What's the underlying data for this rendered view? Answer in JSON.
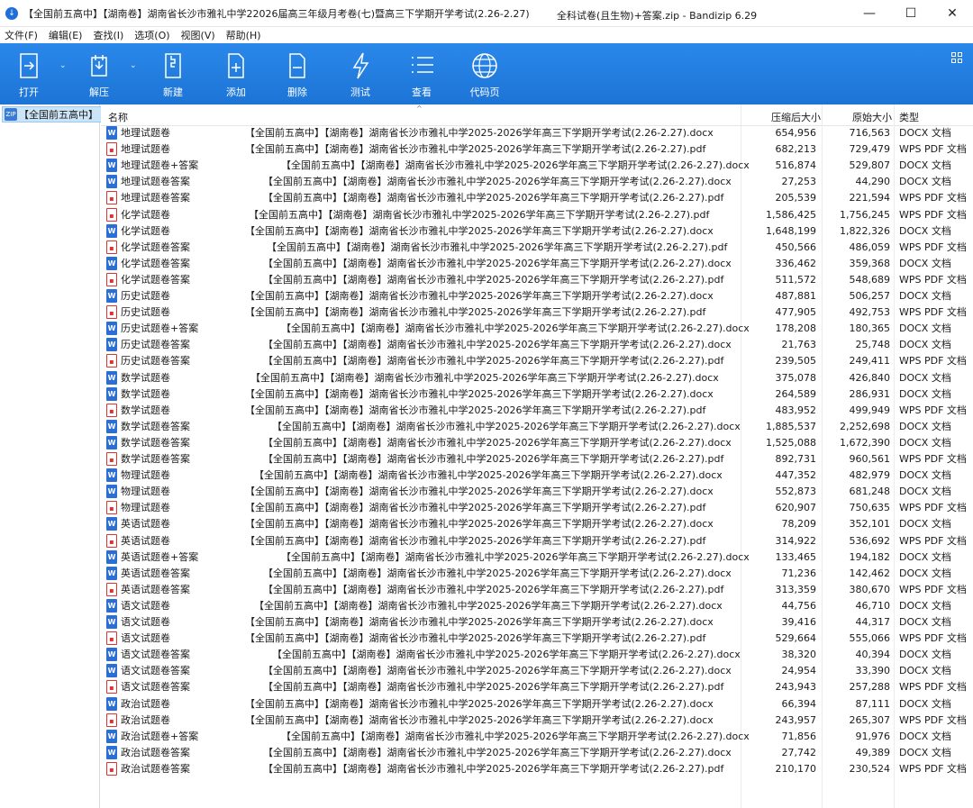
{
  "window": {
    "app_icon": "download-arrow-icon",
    "title_left": "【全国前五高中】【湖南卷】湖南省长沙市雅礼中学22026届高三年级月考卷(七)暨高三下学期开学考试(2.26-2.27)",
    "title_right": "全科试卷(且生物)+答案.zip - Bandizip 6.29",
    "minimize": "—",
    "maximize": "☐",
    "close": "✕"
  },
  "menu": [
    "文件(F)",
    "编辑(E)",
    "查找(I)",
    "选项(O)",
    "视图(V)",
    "帮助(H)"
  ],
  "toolbar": [
    {
      "label": "打开",
      "icon": "open-icon"
    },
    {
      "label": "解压",
      "icon": "extract-icon"
    },
    {
      "label": "新建",
      "icon": "new-archive-icon"
    },
    {
      "label": "添加",
      "icon": "add-file-icon"
    },
    {
      "label": "删除",
      "icon": "delete-file-icon"
    },
    {
      "label": "测试",
      "icon": "test-lightning-icon"
    },
    {
      "label": "查看",
      "icon": "view-list-icon"
    },
    {
      "label": "代码页",
      "icon": "globe-icon"
    }
  ],
  "tree": {
    "label": "【全国前五高中】",
    "icon": "zip-folder-icon"
  },
  "columns": {
    "name": "名称",
    "compressed": "压缩后大小",
    "original": "原始大小",
    "type": "类型"
  },
  "rows": [
    {
      "name": "地理试题卷",
      "full": "【全国前五高中】【湖南卷】湖南省长沙市雅礼中学2025-2026学年高三下学期开学考试(2.26-2.27).docx",
      "comp": "654,956",
      "orig": "716,563",
      "type": "DOCX 文档",
      "kind": "docx",
      "offset": 160
    },
    {
      "name": "地理试题卷",
      "full": "【全国前五高中】【湖南卷】湖南省长沙市雅礼中学2025-2026学年高三下学期开学考试(2.26-2.27).pdf",
      "comp": "682,213",
      "orig": "729,479",
      "type": "WPS PDF 文档",
      "kind": "pdf",
      "offset": 160
    },
    {
      "name": "地理试题卷+答案",
      "full": "【全国前五高中】【湖南卷】湖南省长沙市雅礼中学2025-2026学年高三下学期开学考试(2.26-2.27).docx",
      "comp": "516,874",
      "orig": "529,807",
      "type": "DOCX 文档",
      "kind": "docx",
      "offset": 200
    },
    {
      "name": "地理试题卷答案",
      "full": "【全国前五高中】【湖南卷】湖南省长沙市雅礼中学2025-2026学年高三下学期开学考试(2.26-2.27).docx",
      "comp": "27,253",
      "orig": "44,290",
      "type": "DOCX 文档",
      "kind": "docx",
      "offset": 180
    },
    {
      "name": "地理试题卷答案",
      "full": "【全国前五高中】【湖南卷】湖南省长沙市雅礼中学2025-2026学年高三下学期开学考试(2.26-2.27).pdf",
      "comp": "205,539",
      "orig": "221,594",
      "type": "WPS PDF 文档",
      "kind": "pdf",
      "offset": 180
    },
    {
      "name": "化学试题卷",
      "full": "【全国前五高中】【湖南卷】湖南省长沙市雅礼中学2025-2026学年高三下学期开学考试(2.26-2.27).pdf",
      "comp": "1,586,425",
      "orig": "1,756,245",
      "type": "WPS PDF 文档",
      "kind": "pdf",
      "offset": 164
    },
    {
      "name": "化学试题卷",
      "full": "【全国前五高中】【湖南卷】湖南省长沙市雅礼中学2025-2026学年高三下学期开学考试(2.26-2.27).docx",
      "comp": "1,648,199",
      "orig": "1,822,326",
      "type": "DOCX 文档",
      "kind": "docx",
      "offset": 160
    },
    {
      "name": "化学试题卷答案",
      "full": "【全国前五高中】【湖南卷】湖南省长沙市雅礼中学2025-2026学年高三下学期开学考试(2.26-2.27).pdf",
      "comp": "450,566",
      "orig": "486,059",
      "type": "WPS PDF 文档",
      "kind": "pdf",
      "offset": 184
    },
    {
      "name": "化学试题卷答案",
      "full": "【全国前五高中】【湖南卷】湖南省长沙市雅礼中学2025-2026学年高三下学期开学考试(2.26-2.27).docx",
      "comp": "336,462",
      "orig": "359,368",
      "type": "DOCX 文档",
      "kind": "docx",
      "offset": 180
    },
    {
      "name": "化学试题卷答案",
      "full": "【全国前五高中】【湖南卷】湖南省长沙市雅礼中学2025-2026学年高三下学期开学考试(2.26-2.27).pdf",
      "comp": "511,572",
      "orig": "548,689",
      "type": "WPS PDF 文档",
      "kind": "pdf",
      "offset": 180
    },
    {
      "name": "历史试题卷",
      "full": "【全国前五高中】【湖南卷】湖南省长沙市雅礼中学2025-2026学年高三下学期开学考试(2.26-2.27).docx",
      "comp": "487,881",
      "orig": "506,257",
      "type": "DOCX 文档",
      "kind": "docx",
      "offset": 160
    },
    {
      "name": "历史试题卷",
      "full": "【全国前五高中】【湖南卷】湖南省长沙市雅礼中学2025-2026学年高三下学期开学考试(2.26-2.27).pdf",
      "comp": "477,905",
      "orig": "492,753",
      "type": "WPS PDF 文档",
      "kind": "pdf",
      "offset": 160
    },
    {
      "name": "历史试题卷+答案",
      "full": "【全国前五高中】【湖南卷】湖南省长沙市雅礼中学2025-2026学年高三下学期开学考试(2.26-2.27).docx",
      "comp": "178,208",
      "orig": "180,365",
      "type": "DOCX 文档",
      "kind": "docx",
      "offset": 200
    },
    {
      "name": "历史试题卷答案",
      "full": "【全国前五高中】【湖南卷】湖南省长沙市雅礼中学2025-2026学年高三下学期开学考试(2.26-2.27).docx",
      "comp": "21,763",
      "orig": "25,748",
      "type": "DOCX 文档",
      "kind": "docx",
      "offset": 180
    },
    {
      "name": "历史试题卷答案",
      "full": "【全国前五高中】【湖南卷】湖南省长沙市雅礼中学2025-2026学年高三下学期开学考试(2.26-2.27).pdf",
      "comp": "239,505",
      "orig": "249,411",
      "type": "WPS PDF 文档",
      "kind": "pdf",
      "offset": 180
    },
    {
      "name": "数学试题卷",
      "full": "【全国前五高中】【湖南卷】湖南省长沙市雅礼中学2025-2026学年高三下学期开学考试(2.26-2.27).docx",
      "comp": "375,078",
      "orig": "426,840",
      "type": "DOCX 文档",
      "kind": "docx",
      "offset": 166
    },
    {
      "name": "数学试题卷",
      "full": "【全国前五高中】【湖南卷】湖南省长沙市雅礼中学2025-2026学年高三下学期开学考试(2.26-2.27).docx",
      "comp": "264,589",
      "orig": "286,931",
      "type": "DOCX 文档",
      "kind": "docx",
      "offset": 160
    },
    {
      "name": "数学试题卷",
      "full": "【全国前五高中】【湖南卷】湖南省长沙市雅礼中学2025-2026学年高三下学期开学考试(2.26-2.27).pdf",
      "comp": "483,952",
      "orig": "499,949",
      "type": "WPS PDF 文档",
      "kind": "pdf",
      "offset": 160
    },
    {
      "name": "数学试题卷答案",
      "full": "【全国前五高中】【湖南卷】湖南省长沙市雅礼中学2025-2026学年高三下学期开学考试(2.26-2.27).docx",
      "comp": "1,885,537",
      "orig": "2,252,698",
      "type": "DOCX 文档",
      "kind": "docx",
      "offset": 190
    },
    {
      "name": "数学试题卷答案",
      "full": "【全国前五高中】【湖南卷】湖南省长沙市雅礼中学2025-2026学年高三下学期开学考试(2.26-2.27).docx",
      "comp": "1,525,088",
      "orig": "1,672,390",
      "type": "DOCX 文档",
      "kind": "docx",
      "offset": 180
    },
    {
      "name": "数学试题卷答案",
      "full": "【全国前五高中】【湖南卷】湖南省长沙市雅礼中学2025-2026学年高三下学期开学考试(2.26-2.27).pdf",
      "comp": "892,731",
      "orig": "960,561",
      "type": "WPS PDF 文档",
      "kind": "pdf",
      "offset": 180
    },
    {
      "name": "物理试题卷",
      "full": "【全国前五高中】【湖南卷】湖南省长沙市雅礼中学2025-2026学年高三下学期开学考试(2.26-2.27).docx",
      "comp": "447,352",
      "orig": "482,979",
      "type": "DOCX 文档",
      "kind": "docx",
      "offset": 170
    },
    {
      "name": "物理试题卷",
      "full": "【全国前五高中】【湖南卷】湖南省长沙市雅礼中学2025-2026学年高三下学期开学考试(2.26-2.27).docx",
      "comp": "552,873",
      "orig": "681,248",
      "type": "DOCX 文档",
      "kind": "docx",
      "offset": 160
    },
    {
      "name": "物理试题卷",
      "full": "【全国前五高中】【湖南卷】湖南省长沙市雅礼中学2025-2026学年高三下学期开学考试(2.26-2.27).pdf",
      "comp": "620,907",
      "orig": "750,635",
      "type": "WPS PDF 文档",
      "kind": "pdf",
      "offset": 160
    },
    {
      "name": "英语试题卷",
      "full": "【全国前五高中】【湖南卷】湖南省长沙市雅礼中学2025-2026学年高三下学期开学考试(2.26-2.27).docx",
      "comp": "78,209",
      "orig": "352,101",
      "type": "DOCX 文档",
      "kind": "docx",
      "offset": 160
    },
    {
      "name": "英语试题卷",
      "full": "【全国前五高中】【湖南卷】湖南省长沙市雅礼中学2025-2026学年高三下学期开学考试(2.26-2.27).pdf",
      "comp": "314,922",
      "orig": "536,692",
      "type": "WPS PDF 文档",
      "kind": "pdf",
      "offset": 160
    },
    {
      "name": "英语试题卷+答案",
      "full": "【全国前五高中】【湖南卷】湖南省长沙市雅礼中学2025-2026学年高三下学期开学考试(2.26-2.27).docx",
      "comp": "133,465",
      "orig": "194,182",
      "type": "DOCX 文档",
      "kind": "docx",
      "offset": 200
    },
    {
      "name": "英语试题卷答案",
      "full": "【全国前五高中】【湖南卷】湖南省长沙市雅礼中学2025-2026学年高三下学期开学考试(2.26-2.27).docx",
      "comp": "71,236",
      "orig": "142,462",
      "type": "DOCX 文档",
      "kind": "docx",
      "offset": 180
    },
    {
      "name": "英语试题卷答案",
      "full": "【全国前五高中】【湖南卷】湖南省长沙市雅礼中学2025-2026学年高三下学期开学考试(2.26-2.27).pdf",
      "comp": "313,359",
      "orig": "380,670",
      "type": "WPS PDF 文档",
      "kind": "pdf",
      "offset": 180
    },
    {
      "name": "语文试题卷",
      "full": "【全国前五高中】【湖南卷】湖南省长沙市雅礼中学2025-2026学年高三下学期开学考试(2.26-2.27).docx",
      "comp": "44,756",
      "orig": "46,710",
      "type": "DOCX 文档",
      "kind": "docx",
      "offset": 170
    },
    {
      "name": "语文试题卷",
      "full": "【全国前五高中】【湖南卷】湖南省长沙市雅礼中学2025-2026学年高三下学期开学考试(2.26-2.27).docx",
      "comp": "39,416",
      "orig": "44,317",
      "type": "DOCX 文档",
      "kind": "docx",
      "offset": 160
    },
    {
      "name": "语文试题卷",
      "full": "【全国前五高中】【湖南卷】湖南省长沙市雅礼中学2025-2026学年高三下学期开学考试(2.26-2.27).pdf",
      "comp": "529,664",
      "orig": "555,066",
      "type": "WPS PDF 文档",
      "kind": "pdf",
      "offset": 160
    },
    {
      "name": "语文试题卷答案",
      "full": "【全国前五高中】【湖南卷】湖南省长沙市雅礼中学2025-2026学年高三下学期开学考试(2.26-2.27).docx",
      "comp": "38,320",
      "orig": "40,394",
      "type": "DOCX 文档",
      "kind": "docx",
      "offset": 190
    },
    {
      "name": "语文试题卷答案",
      "full": "【全国前五高中】【湖南卷】湖南省长沙市雅礼中学2025-2026学年高三下学期开学考试(2.26-2.27).docx",
      "comp": "24,954",
      "orig": "33,390",
      "type": "DOCX 文档",
      "kind": "docx",
      "offset": 180
    },
    {
      "name": "语文试题卷答案",
      "full": "【全国前五高中】【湖南卷】湖南省长沙市雅礼中学2025-2026学年高三下学期开学考试(2.26-2.27).pdf",
      "comp": "243,943",
      "orig": "257,288",
      "type": "WPS PDF 文档",
      "kind": "pdf",
      "offset": 180
    },
    {
      "name": "政治试题卷",
      "full": "【全国前五高中】【湖南卷】湖南省长沙市雅礼中学2025-2026学年高三下学期开学考试(2.26-2.27).docx",
      "comp": "66,394",
      "orig": "87,111",
      "type": "DOCX 文档",
      "kind": "docx",
      "offset": 160
    },
    {
      "name": "政治试题卷",
      "full": "【全国前五高中】【湖南卷】湖南省长沙市雅礼中学2025-2026学年高三下学期开学考试(2.26-2.27).docx",
      "comp": "243,957",
      "orig": "265,307",
      "type": "WPS PDF 文档",
      "kind": "pdf",
      "offset": 160
    },
    {
      "name": "政治试题卷+答案",
      "full": "【全国前五高中】【湖南卷】湖南省长沙市雅礼中学2025-2026学年高三下学期开学考试(2.26-2.27).docx",
      "comp": "71,856",
      "orig": "91,976",
      "type": "DOCX 文档",
      "kind": "docx",
      "offset": 200
    },
    {
      "name": "政治试题卷答案",
      "full": "【全国前五高中】【湖南卷】湖南省长沙市雅礼中学2025-2026学年高三下学期开学考试(2.26-2.27).docx",
      "comp": "27,742",
      "orig": "49,389",
      "type": "DOCX 文档",
      "kind": "docx",
      "offset": 180
    },
    {
      "name": "政治试题卷答案",
      "full": "【全国前五高中】【湖南卷】湖南省长沙市雅礼中学2025-2026学年高三下学期开学考试(2.26-2.27).pdf",
      "comp": "210,170",
      "orig": "230,524",
      "type": "WPS PDF 文档",
      "kind": "pdf",
      "offset": 180
    }
  ]
}
